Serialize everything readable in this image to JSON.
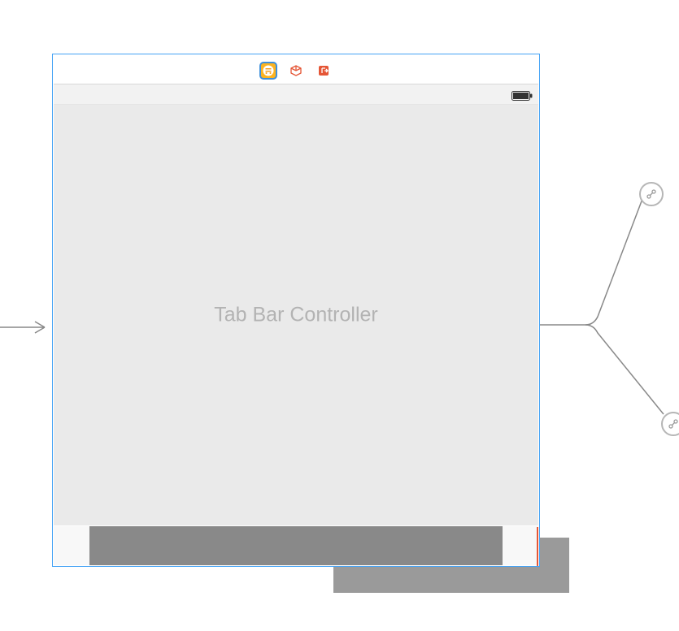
{
  "scene": {
    "title": "Tab Bar Controller",
    "dock": {
      "controller_icon": "controller-icon",
      "first_responder_icon": "cube-icon",
      "exit_icon": "exit-icon"
    }
  },
  "icons": {
    "battery": "battery-icon",
    "segue_relationship": "link-icon"
  }
}
